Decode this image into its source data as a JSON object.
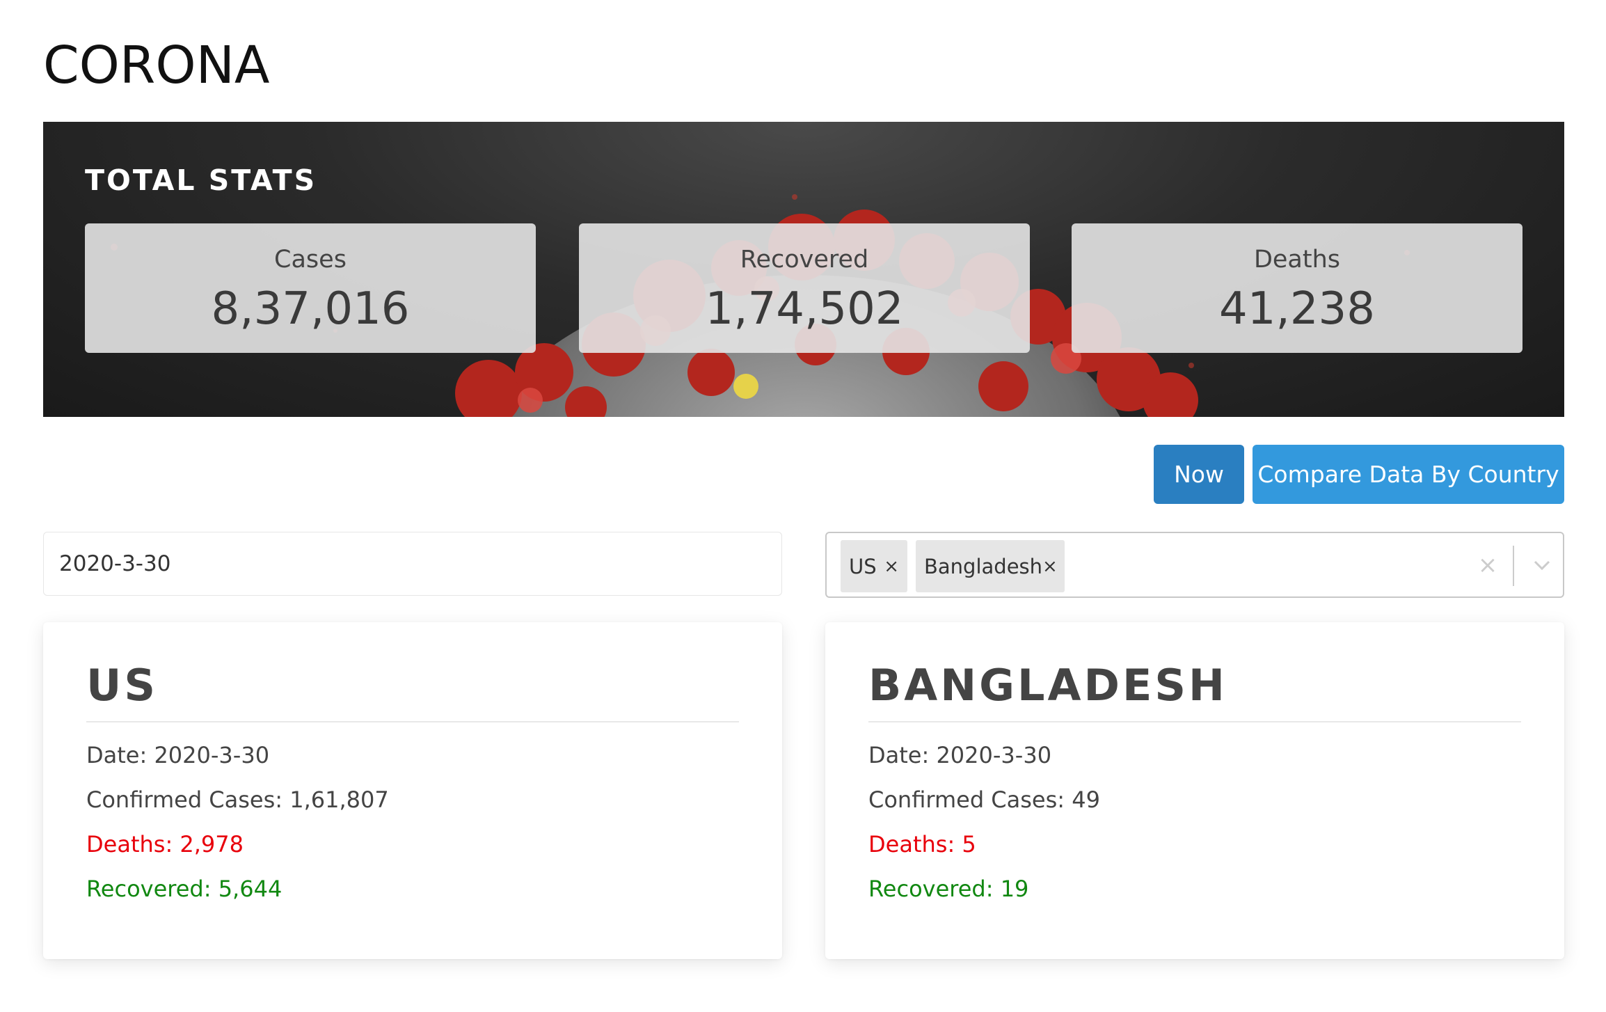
{
  "app": {
    "title": "CORONA"
  },
  "total_stats": {
    "title": "TOTAL STATS",
    "cases": {
      "label": "Cases",
      "value": "8,37,016"
    },
    "recovered": {
      "label": "Recovered",
      "value": "1,74,502"
    },
    "deaths": {
      "label": "Deaths",
      "value": "41,238"
    }
  },
  "toolbar": {
    "now_label": "Now",
    "compare_label": "Compare Data By Country"
  },
  "date_field": {
    "value": "2020-3-30"
  },
  "country_select": {
    "selected": [
      {
        "label": "US",
        "remove": "×"
      },
      {
        "label": "Bangladesh",
        "remove": "×"
      }
    ],
    "clear_icon": "×"
  },
  "cards": [
    {
      "title": "US",
      "date_label": "Date:",
      "date": "2020-3-30",
      "confirmed_label": "Confirmed Cases:",
      "confirmed": "1,61,807",
      "deaths_label": "Deaths:",
      "deaths": "2,978",
      "recovered_label": "Recovered:",
      "recovered": "5,644"
    },
    {
      "title": "BANGLADESH",
      "date_label": "Date:",
      "date": "2020-3-30",
      "confirmed_label": "Confirmed Cases:",
      "confirmed": "49",
      "deaths_label": "Deaths:",
      "deaths": "5",
      "recovered_label": "Recovered:",
      "recovered": "19"
    }
  ],
  "colors": {
    "deaths": "#e8000b",
    "recovered": "#118811",
    "button_now": "#2a7fc1",
    "button_compare": "#3399dd"
  }
}
